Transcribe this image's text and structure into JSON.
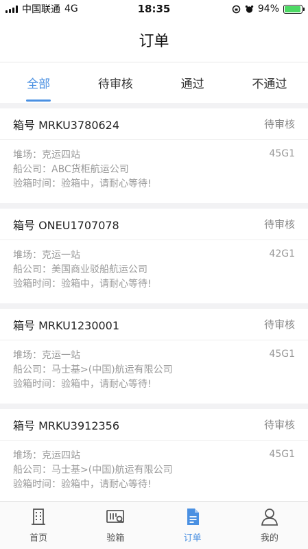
{
  "status_bar": {
    "carrier": "中国联通",
    "network": "4G",
    "time": "18:35",
    "battery": "94%",
    "battery_level": 0.94
  },
  "header": {
    "title": "订单"
  },
  "tabs": [
    {
      "label": "全部",
      "active": true
    },
    {
      "label": "待审核",
      "active": false
    },
    {
      "label": "通过",
      "active": false
    },
    {
      "label": "不通过",
      "active": false
    }
  ],
  "orders": [
    {
      "box_no": "箱号 MRKU3780624",
      "status": "待审核",
      "yard": "堆场：克运四站",
      "shipping": "船公司：ABC货柜航运公司",
      "inspect_time": "验箱时间：验箱中，请耐心等待!",
      "type": "45G1"
    },
    {
      "box_no": "箱号 ONEU1707078",
      "status": "待审核",
      "yard": "堆场：克运一站",
      "shipping": "船公司：美国商业驳船航运公司",
      "inspect_time": "验箱时间：验箱中，请耐心等待!",
      "type": "42G1"
    },
    {
      "box_no": "箱号 MRKU1230001",
      "status": "待审核",
      "yard": "堆场：克运一站",
      "shipping": "船公司：马士基>(中国)航运有限公司",
      "inspect_time": "验箱时间：验箱中，请耐心等待!",
      "type": "45G1"
    },
    {
      "box_no": "箱号 MRKU3912356",
      "status": "待审核",
      "yard": "堆场：克运四站",
      "shipping": "船公司：马士基>(中国)航运有限公司",
      "inspect_time": "验箱时间：验箱中，请耐心等待!",
      "type": "45G1"
    }
  ],
  "tabbar": [
    {
      "label": "首页",
      "icon": "building-icon",
      "active": false
    },
    {
      "label": "验箱",
      "icon": "container-search-icon",
      "active": false
    },
    {
      "label": "订单",
      "icon": "document-icon",
      "active": true
    },
    {
      "label": "我的",
      "icon": "user-icon",
      "active": false
    }
  ],
  "colors": {
    "accent": "#4a90e2",
    "battery": "#4cd964"
  }
}
